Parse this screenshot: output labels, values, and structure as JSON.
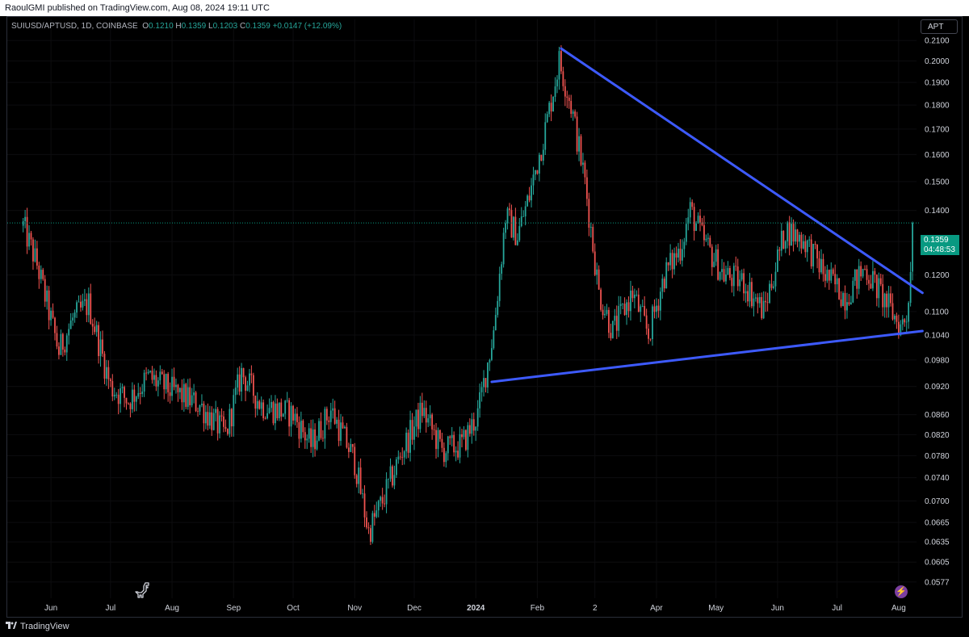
{
  "header": {
    "published": "RaoulGMI published on TradingView.com, Aug 08, 2024 19:11 UTC"
  },
  "symbol": {
    "name": "SUIUSD/APTUSD, 1D, COINBASE",
    "open_label": "O",
    "open": "0.1210",
    "high_label": "H",
    "high": "0.1359",
    "low_label": "L",
    "low": "0.1203",
    "close_label": "C",
    "close": "0.1359",
    "change": "+0.0147 (+12.09%)"
  },
  "scale_button": "APT",
  "price_badge": {
    "price": "0.1359",
    "countdown": "04:48:53"
  },
  "footer": {
    "brand": "TradingView"
  },
  "colors": {
    "background": "#000000",
    "up_candle": "#26a69a",
    "down_candle": "#ef5350",
    "trendline": "#3d5afe",
    "last_price_line": "#089981",
    "axis_text": "#d1d4dc"
  },
  "chart_data": {
    "type": "candlestick",
    "title": "SUIUSD/APTUSD, 1D, COINBASE",
    "y_scale": "log",
    "ylim": [
      0.0555,
      0.2125
    ],
    "y_ticks": [
      "0.2100",
      "0.2000",
      "0.1900",
      "0.1800",
      "0.1700",
      "0.1600",
      "0.1500",
      "0.1400",
      "0.1300",
      "0.1200",
      "0.1100",
      "0.1040",
      "0.0980",
      "0.0920",
      "0.0860",
      "0.0820",
      "0.0780",
      "0.0740",
      "0.0700",
      "0.0665",
      "0.0635",
      "0.0605",
      "0.0577"
    ],
    "x_range": [
      "2023-05-10",
      "2024-08-10"
    ],
    "x_ticks": [
      {
        "date": "2023-06-01",
        "label": "Jun"
      },
      {
        "date": "2023-07-01",
        "label": "Jul"
      },
      {
        "date": "2023-08-01",
        "label": "Aug"
      },
      {
        "date": "2023-09-01",
        "label": "Sep"
      },
      {
        "date": "2023-10-01",
        "label": "Oct"
      },
      {
        "date": "2023-11-01",
        "label": "Nov"
      },
      {
        "date": "2023-12-01",
        "label": "Dec"
      },
      {
        "date": "2024-01-01",
        "label": "2024"
      },
      {
        "date": "2024-02-01",
        "label": "Feb"
      },
      {
        "date": "2024-03-01",
        "label": "2"
      },
      {
        "date": "2024-04-01",
        "label": "Apr"
      },
      {
        "date": "2024-05-01",
        "label": "May"
      },
      {
        "date": "2024-06-01",
        "label": "Jun"
      },
      {
        "date": "2024-07-01",
        "label": "Jul"
      },
      {
        "date": "2024-08-01",
        "label": "Aug"
      }
    ],
    "close_path": [
      {
        "date": "2023-05-18",
        "close": 0.135
      },
      {
        "date": "2023-05-25",
        "close": 0.123
      },
      {
        "date": "2023-06-05",
        "close": 0.1
      },
      {
        "date": "2023-06-12",
        "close": 0.108
      },
      {
        "date": "2023-06-20",
        "close": 0.112
      },
      {
        "date": "2023-07-01",
        "close": 0.092
      },
      {
        "date": "2023-07-10",
        "close": 0.089
      },
      {
        "date": "2023-07-20",
        "close": 0.094
      },
      {
        "date": "2023-08-01",
        "close": 0.091
      },
      {
        "date": "2023-08-15",
        "close": 0.088
      },
      {
        "date": "2023-08-28",
        "close": 0.082
      },
      {
        "date": "2023-09-05",
        "close": 0.095
      },
      {
        "date": "2023-09-15",
        "close": 0.088
      },
      {
        "date": "2023-10-01",
        "close": 0.086
      },
      {
        "date": "2023-10-10",
        "close": 0.08
      },
      {
        "date": "2023-10-20",
        "close": 0.087
      },
      {
        "date": "2023-11-01",
        "close": 0.077
      },
      {
        "date": "2023-11-08",
        "close": 0.065
      },
      {
        "date": "2023-11-15",
        "close": 0.07
      },
      {
        "date": "2023-11-25",
        "close": 0.079
      },
      {
        "date": "2023-12-05",
        "close": 0.087
      },
      {
        "date": "2023-12-15",
        "close": 0.079
      },
      {
        "date": "2023-12-25",
        "close": 0.08
      },
      {
        "date": "2024-01-02",
        "close": 0.086
      },
      {
        "date": "2024-01-10",
        "close": 0.105
      },
      {
        "date": "2024-01-16",
        "close": 0.138
      },
      {
        "date": "2024-01-22",
        "close": 0.132
      },
      {
        "date": "2024-01-28",
        "close": 0.145
      },
      {
        "date": "2024-02-05",
        "close": 0.17
      },
      {
        "date": "2024-02-12",
        "close": 0.2
      },
      {
        "date": "2024-02-18",
        "close": 0.18
      },
      {
        "date": "2024-02-25",
        "close": 0.15
      },
      {
        "date": "2024-03-03",
        "close": 0.115
      },
      {
        "date": "2024-03-10",
        "close": 0.105
      },
      {
        "date": "2024-03-20",
        "close": 0.115
      },
      {
        "date": "2024-03-28",
        "close": 0.104
      },
      {
        "date": "2024-04-05",
        "close": 0.12
      },
      {
        "date": "2024-04-13",
        "close": 0.128
      },
      {
        "date": "2024-04-18",
        "close": 0.14
      },
      {
        "date": "2024-04-25",
        "close": 0.13
      },
      {
        "date": "2024-05-05",
        "close": 0.12
      },
      {
        "date": "2024-05-15",
        "close": 0.118
      },
      {
        "date": "2024-05-25",
        "close": 0.11
      },
      {
        "date": "2024-06-05",
        "close": 0.134
      },
      {
        "date": "2024-06-15",
        "close": 0.13
      },
      {
        "date": "2024-06-25",
        "close": 0.12
      },
      {
        "date": "2024-07-05",
        "close": 0.114
      },
      {
        "date": "2024-07-15",
        "close": 0.122
      },
      {
        "date": "2024-07-25",
        "close": 0.113
      },
      {
        "date": "2024-08-02",
        "close": 0.106
      },
      {
        "date": "2024-08-05",
        "close": 0.109
      },
      {
        "date": "2024-08-07",
        "close": 0.121
      },
      {
        "date": "2024-08-08",
        "close": 0.1359
      }
    ],
    "trendlines": [
      {
        "name": "upper",
        "from": {
          "date": "2024-02-13",
          "price": 0.206
        },
        "to": {
          "date": "2024-08-13",
          "price": 0.115
        }
      },
      {
        "name": "lower",
        "from": {
          "date": "2024-01-09",
          "price": 0.093
        },
        "to": {
          "date": "2024-08-13",
          "price": 0.105
        }
      }
    ],
    "last_price": 0.1359
  }
}
